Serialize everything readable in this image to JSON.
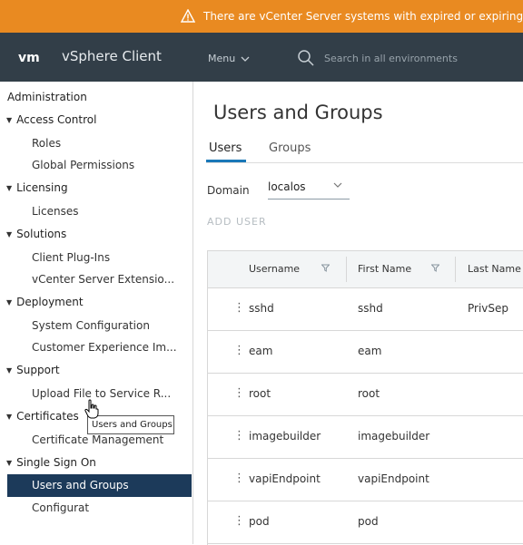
{
  "banner": {
    "text": "There are vCenter Server systems with expired or expiring l",
    "color": "#e98a21"
  },
  "header": {
    "logo": "vm",
    "app_title": "vSphere Client",
    "menu_label": "Menu",
    "search_placeholder": "Search in all environments",
    "bg_color": "#323e48"
  },
  "sidebar": {
    "heading": "Administration",
    "groups": [
      {
        "label": "Access Control",
        "items": [
          "Roles",
          "Global Permissions"
        ]
      },
      {
        "label": "Licensing",
        "items": [
          "Licenses"
        ]
      },
      {
        "label": "Solutions",
        "items": [
          "Client Plug-Ins",
          "vCenter Server Extensio..."
        ]
      },
      {
        "label": "Deployment",
        "items": [
          "System Configuration",
          "Customer Experience Im..."
        ]
      },
      {
        "label": "Support",
        "items": [
          "Upload File to Service R..."
        ]
      },
      {
        "label": "Certificates",
        "items": [
          "Certificate Management"
        ]
      },
      {
        "label": "Single Sign On",
        "items": [
          "Users and Groups",
          "Configurat"
        ]
      }
    ],
    "active_item": "Users and Groups",
    "tooltip": "Users and Groups",
    "active_color": "#1c3a5a"
  },
  "main": {
    "title": "Users and Groups",
    "tabs": [
      "Users",
      "Groups"
    ],
    "active_tab": "Users",
    "domain_label": "Domain",
    "domain_value": "localos",
    "add_user": "ADD USER",
    "columns": [
      "Username",
      "First Name",
      "Last Name"
    ],
    "rows": [
      {
        "username": "sshd",
        "first_name": "sshd",
        "last_name": "PrivSep"
      },
      {
        "username": "eam",
        "first_name": "eam",
        "last_name": ""
      },
      {
        "username": "root",
        "first_name": "root",
        "last_name": ""
      },
      {
        "username": "imagebuilder",
        "first_name": "imagebuilder",
        "last_name": ""
      },
      {
        "username": "vapiEndpoint",
        "first_name": "vapiEndpoint",
        "last_name": ""
      },
      {
        "username": "pod",
        "first_name": "pod",
        "last_name": ""
      }
    ],
    "accent_color": "#1a78b8"
  }
}
